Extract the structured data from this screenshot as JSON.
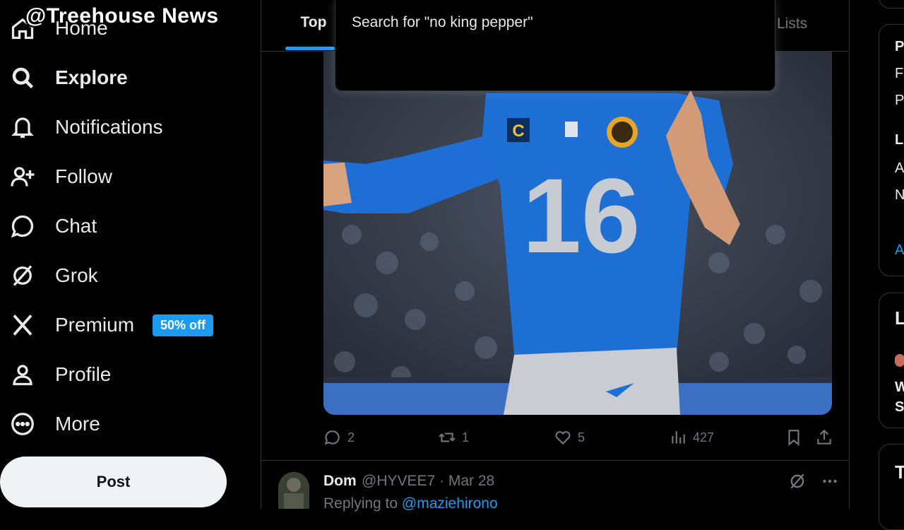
{
  "watermark": "@Treehouse News",
  "nav": {
    "items": [
      {
        "label": "Home",
        "icon": "home-icon"
      },
      {
        "label": "Explore",
        "icon": "search-icon"
      },
      {
        "label": "Notifications",
        "icon": "bell-icon"
      },
      {
        "label": "Follow",
        "icon": "follow-icon"
      },
      {
        "label": "Chat",
        "icon": "chat-icon"
      },
      {
        "label": "Grok",
        "icon": "grok-icon"
      },
      {
        "label": "Premium",
        "icon": "x-logo-icon",
        "badge": "50% off"
      },
      {
        "label": "Profile",
        "icon": "person-icon"
      },
      {
        "label": "More",
        "icon": "more-circle-icon"
      }
    ],
    "post_label": "Post"
  },
  "tabs": {
    "top": "Top",
    "lists": "Lists"
  },
  "search": {
    "suggestion": "Search for \"no king pepper\""
  },
  "tweet": {
    "jersey_number": "16",
    "actions": {
      "replies": "2",
      "reposts": "1",
      "likes": "5",
      "views": "427"
    }
  },
  "reply": {
    "name": "Dom",
    "handle": "@HYVEE7 · Mar 28",
    "replying_prefix": "Replying to ",
    "replying_to": "@maziehirono"
  },
  "sidebar": {
    "card1": [
      "P",
      "F",
      "P",
      "L",
      "A",
      "N",
      "A"
    ],
    "card2": [
      "L",
      "W",
      "S"
    ],
    "card3": [
      "T"
    ]
  },
  "colors": {
    "accent": "#1d9bf0",
    "background": "#000000",
    "text": "#e7e9ea",
    "muted": "#71767b",
    "jersey": "#1e6fd4"
  }
}
